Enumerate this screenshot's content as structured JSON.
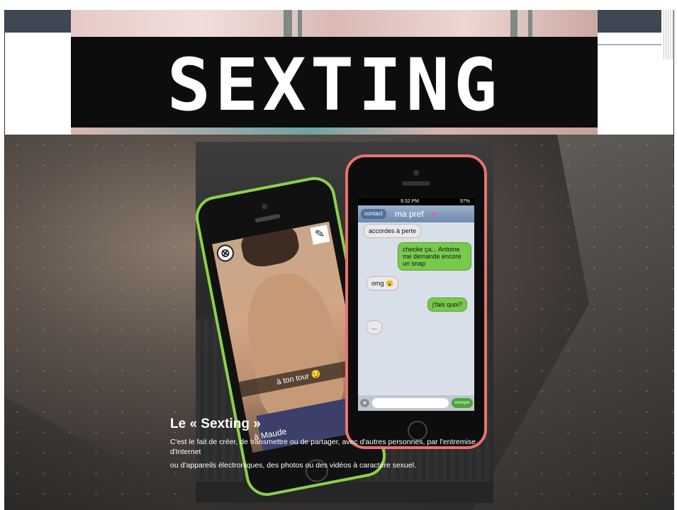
{
  "banner": {
    "title": "SEXTING"
  },
  "green_phone": {
    "caption": "à ton tour 😏",
    "close_glyph": "⊗",
    "pencil_glyph": "✎",
    "tool_label": "à Maude"
  },
  "pink_phone": {
    "status_time": "9:32 PM",
    "status_battery": "97%",
    "back_label": "contact",
    "contact_name": "ma pref",
    "messages": [
      {
        "side": "left",
        "text": "accordes à perte"
      },
      {
        "side": "right",
        "text": "checke ça... Antoine me demande encore un snap"
      },
      {
        "side": "left",
        "text": "omg 😮"
      },
      {
        "side": "right",
        "text": "j'fais quoi?"
      },
      {
        "side": "left",
        "text": "..."
      }
    ],
    "send_label": "envoyer"
  },
  "caption": {
    "title": "Le « Sexting »",
    "line1": "C'est le fait de créer, de transmettre ou de partager, avec d'autres personnes, par l'entremise",
    "line2": "d'Internet",
    "line3": "ou d'appareils électroniques, des photos ou des vidéos à caractère sexuel."
  },
  "colors": {
    "accent_bar": "#3f4654",
    "phone_green": "#8dd04a",
    "phone_pink": "#e8736e",
    "bubble_green": "#78c94c"
  }
}
